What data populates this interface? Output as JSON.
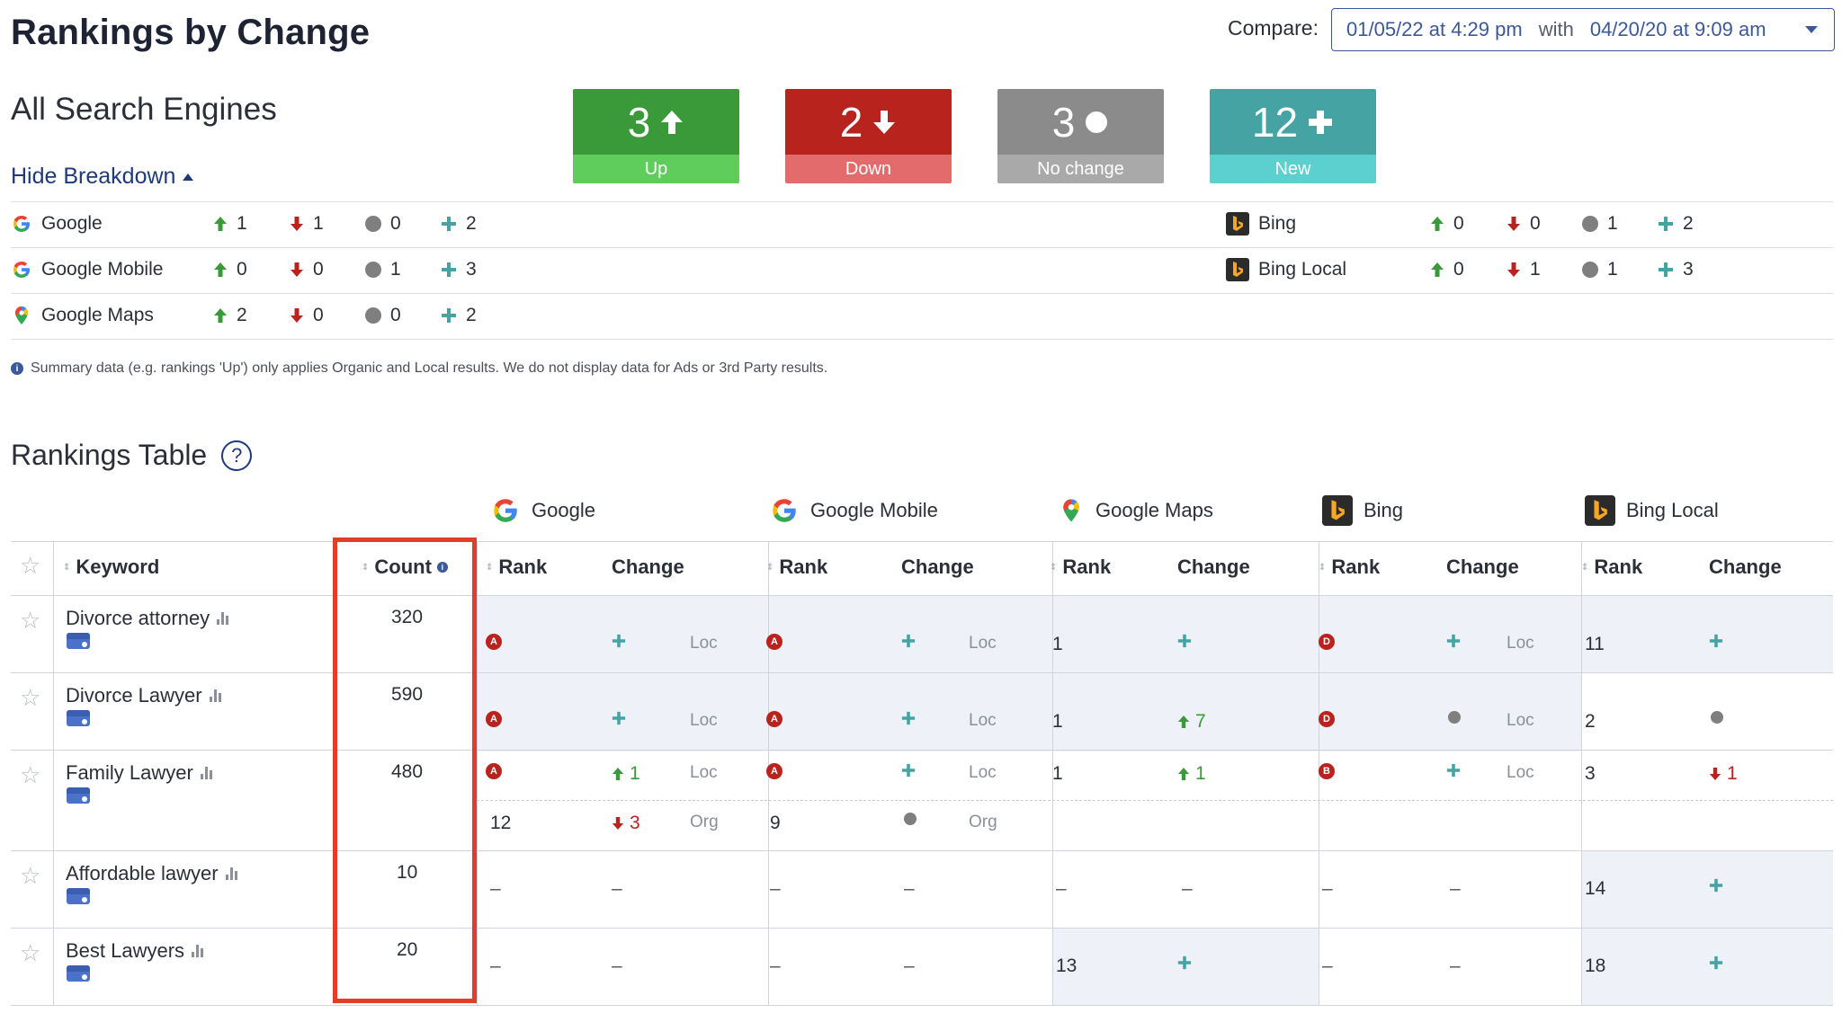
{
  "page": {
    "title": "Rankings by Change",
    "compare_label": "Compare:",
    "compare_from": "01/05/22 at 4:29 pm",
    "compare_with": "with",
    "compare_to": "04/20/20 at 9:09 am"
  },
  "summary": {
    "heading": "All Search Engines",
    "hide_breakdown": "Hide Breakdown",
    "tiles": {
      "up": {
        "value": "3",
        "label": "Up"
      },
      "down": {
        "value": "2",
        "label": "Down"
      },
      "same": {
        "value": "3",
        "label": "No change"
      },
      "new": {
        "value": "12",
        "label": "New"
      }
    },
    "breakdown": {
      "google": {
        "name": "Google",
        "up": "1",
        "down": "1",
        "same": "0",
        "new": "2"
      },
      "google_mobile": {
        "name": "Google Mobile",
        "up": "0",
        "down": "0",
        "same": "1",
        "new": "3"
      },
      "google_maps": {
        "name": "Google Maps",
        "up": "2",
        "down": "0",
        "same": "0",
        "new": "2"
      },
      "bing": {
        "name": "Bing",
        "up": "0",
        "down": "0",
        "same": "1",
        "new": "2"
      },
      "bing_local": {
        "name": "Bing Local",
        "up": "0",
        "down": "1",
        "same": "1",
        "new": "3"
      }
    },
    "note": "Summary data (e.g. rankings 'Up') only applies Organic and Local results. We do not display data for Ads or 3rd Party results."
  },
  "table": {
    "title": "Rankings Table",
    "engines": {
      "google": "Google",
      "google_mobile": "Google Mobile",
      "google_maps": "Google Maps",
      "bing": "Bing",
      "bing_local": "Bing Local"
    },
    "headers": {
      "keyword": "Keyword",
      "count": "Count",
      "rank": "Rank",
      "change": "Change"
    },
    "rows": {
      "r0": {
        "keyword": "Divorce attorney",
        "count": "320",
        "g_badge": "A",
        "g_type": "Loc",
        "gm_badge": "A",
        "gm_type": "Loc",
        "gmaps_rank": "1",
        "b_badge": "D",
        "b_type": "Loc",
        "bl_rank": "11"
      },
      "r1": {
        "keyword": "Divorce Lawyer",
        "count": "590",
        "g_badge": "A",
        "g_type": "Loc",
        "gm_badge": "A",
        "gm_type": "Loc",
        "gmaps_rank": "1",
        "gmaps_change": "7",
        "b_badge": "D",
        "b_type": "Loc",
        "bl_rank": "2"
      },
      "r2": {
        "keyword": "Family Lawyer",
        "count": "480",
        "g_badge": "A",
        "g_change": "1",
        "g_type": "Loc",
        "gm_badge": "A",
        "gm_type": "Loc",
        "gmaps_rank": "1",
        "gmaps_change": "1",
        "b_badge": "B",
        "b_type": "Loc",
        "bl_rank": "3",
        "bl_change": "1",
        "g_rank2": "12",
        "g_change2": "3",
        "g_type2": "Org",
        "gm_rank2": "9",
        "gm_type2": "Org"
      },
      "r3": {
        "keyword": "Affordable lawyer",
        "count": "10",
        "dash": "–",
        "bl_rank": "14"
      },
      "r4": {
        "keyword": "Best Lawyers",
        "count": "20",
        "dash": "–",
        "gmaps_rank": "13",
        "bl_rank": "18"
      }
    }
  },
  "colors": {
    "up": "#3a9a3a",
    "down": "#b8231e",
    "same": "#7f7f7f",
    "new": "#45a3a3",
    "highlight": "#e03d2b",
    "link": "#1f3a7a"
  },
  "icons": [
    "google-logo-icon",
    "google-maps-pin-icon",
    "bing-logo-icon",
    "arrow-up-icon",
    "arrow-down-icon",
    "circle-icon",
    "plus-icon",
    "star-icon",
    "info-icon",
    "help-icon",
    "chart-bars-icon",
    "business-profile-icon",
    "caret-down-icon",
    "caret-up-icon"
  ]
}
